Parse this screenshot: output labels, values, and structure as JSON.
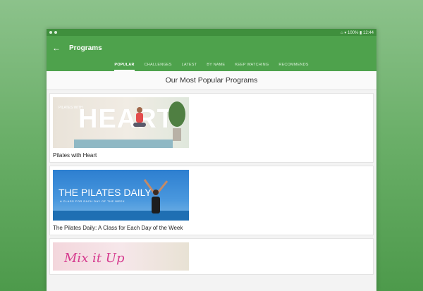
{
  "statusbar": {
    "left": "••",
    "right": "⌂ ▾ 100% ▮ 12:44"
  },
  "appbar": {
    "back_icon": "arrow-left-icon",
    "title": "Programs"
  },
  "tabs": [
    "POPULAR",
    "CHALLENGES",
    "LATEST",
    "BY NAME",
    "KEEP WATCHING",
    "RECOMMENDS"
  ],
  "active_tab": "POPULAR",
  "section": {
    "title": "Our Most Popular Programs"
  },
  "cards": [
    {
      "title": "Pilates with Heart",
      "thumb_text": "HEART",
      "thumb_small": "PILATES WITH"
    },
    {
      "title": "The Pilates Daily: A Class for Each Day of the Week",
      "thumb_text": "THE PILATES DAILY",
      "thumb_small": "A CLASS FOR EACH DAY OF THE WEEK"
    },
    {
      "title": "",
      "thumb_text": "Mix it Up",
      "thumb_small": ""
    }
  ],
  "colors": {
    "appbar": "#4ea24c",
    "statusbar": "#3f8f3d",
    "background": "#6cb06a"
  }
}
